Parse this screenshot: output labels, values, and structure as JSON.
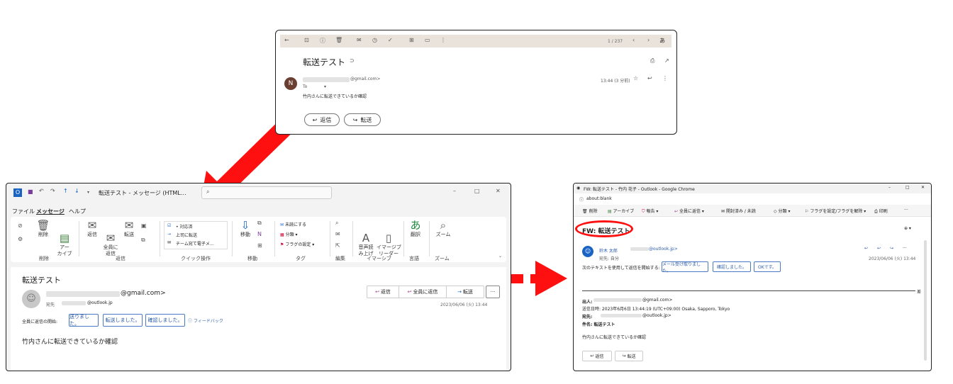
{
  "colors": {
    "arrow": "#ff1010",
    "outlook_blue": "#2b5ba8",
    "gmail_bar": "#e9e3db",
    "ring": "#ff1010"
  },
  "gmail": {
    "toolbar": {
      "icons": [
        "back-arrow-icon",
        "archive-icon",
        "spam-icon",
        "trash-icon",
        "mark-unread-icon",
        "snooze-icon",
        "add-task-icon",
        "move-to-icon",
        "label-icon",
        "more-icon"
      ],
      "pager": "1 / 237",
      "lang": "あ"
    },
    "subject": "転送テスト",
    "avatar_letter": "N",
    "from_suffix": "@gmail.com>",
    "to_label": "To",
    "time": "13:44 (3 分前)",
    "body": "竹内さんに転送できているか確認",
    "reply_label": "返信",
    "forward_label": "転送"
  },
  "outlook": {
    "title": "転送テスト - メッセージ (HTML…",
    "menu": [
      "ファイル",
      "メッセージ",
      "ヘルプ"
    ],
    "ribbon": {
      "delete": "削除",
      "archive": "アー\nカイブ",
      "reply": "返信",
      "reply_all": "全員に\n返信",
      "forward": "転送",
      "quick1": "• 対応済",
      "quick2": "上司に転送",
      "quick3": "チーム宛て電子メ…",
      "move": "移動",
      "unread": "未読にする",
      "categorize": "分類",
      "flag": "フラグの設定",
      "read_aloud": "音声読\nみ上げ",
      "immersive": "イマージブ\nリーダー",
      "translate": "翻訳",
      "zoom": "ズーム",
      "groups": [
        "削除",
        "返信",
        "クイック操作",
        "移動",
        "タグ",
        "編集",
        "イマーシブ",
        "言語",
        "ズーム"
      ]
    },
    "subject": "転送テスト",
    "from_suffix": "@gmail.com>",
    "to_label": "宛先",
    "to_suffix": "@outlook.jp",
    "reply": "返信",
    "reply_all": "全員に返信",
    "forward": "転送",
    "more": "···",
    "date": "2023/06/06 (火) 13:44",
    "suggest_label": "全員に返信の開始:",
    "suggestions": [
      "送りました。",
      "転送しました。",
      "確認しました。"
    ],
    "feedback": "フィードバック",
    "body": "竹内さんに転送できているか確認"
  },
  "chrome": {
    "title": "FW: 転送テスト - 竹内 花子 - Outlook - Google Chrome",
    "address": "about:blank",
    "toolbar": [
      "削除",
      "アーカイブ",
      "報告",
      "全員に返信",
      "開封済み / 未読",
      "分類",
      "フラグを設定/フラグを解除",
      "印刷",
      "···"
    ],
    "subject": "FW: 転送テスト",
    "sender_name": "鈴木 太郎",
    "sender_email_suffix": "@outlook.jp>",
    "to_line": "宛先: 自分",
    "date": "2023/06/06 (火) 13:44",
    "suggest_label": "次のテキストを使用して返信を開始する:",
    "suggestions": [
      "メール受け取りました。",
      "確認しました。",
      "OKです。"
    ],
    "fwd_from_label": "出人:",
    "fwd_from_suffix": "@gmail.com>",
    "fwd_sent": "送信日時: 2023年6月6日 13:44:19 (UTC+09:00) Osaka, Sapporo, Tokyo",
    "fwd_to_label": "宛先:",
    "fwd_to_suffix": "@outlook.jp>",
    "fwd_subject": "件名: 転送テスト",
    "body": "竹内さんに転送できているか確認",
    "reply": "返信",
    "forward": "転送",
    "divider_mark": "差"
  }
}
